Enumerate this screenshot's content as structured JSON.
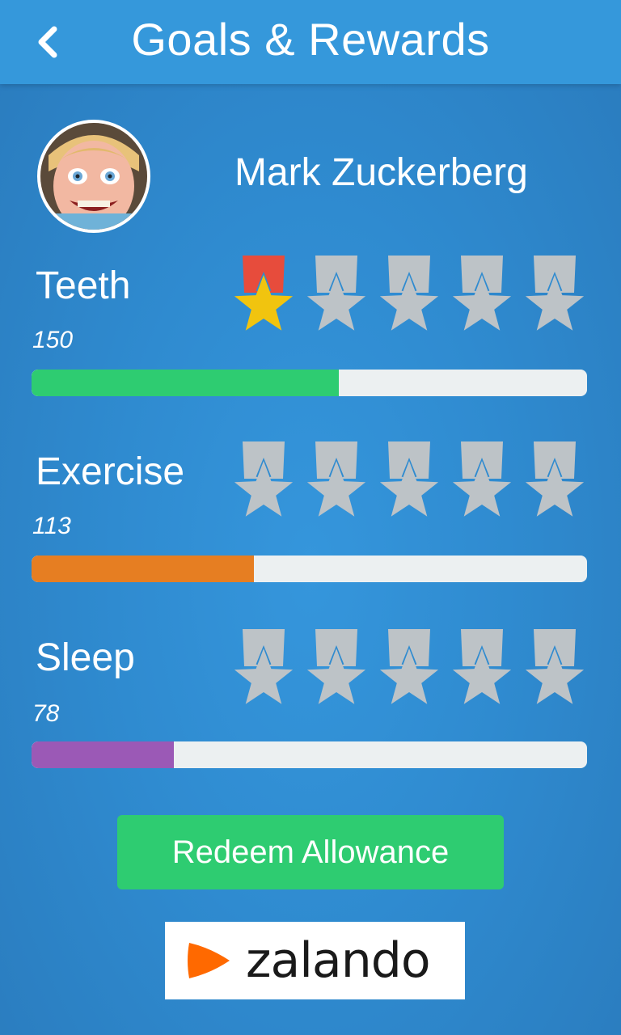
{
  "header": {
    "title": "Goals & Rewards",
    "back_icon": "chevron-left-icon"
  },
  "profile": {
    "name": "Mark Zuckerberg",
    "avatar_icon": "child-avatar"
  },
  "goals": [
    {
      "label": "Teeth",
      "value": "150",
      "progress": 0.553,
      "color": "#2ecc71",
      "stars_earned": 1,
      "stars_total": 5
    },
    {
      "label": "Exercise",
      "value": "113",
      "progress": 0.4,
      "color": "#e67e22",
      "stars_earned": 0,
      "stars_total": 5
    },
    {
      "label": "Sleep",
      "value": "78",
      "progress": 0.256,
      "color": "#9b59b6",
      "stars_earned": 0,
      "stars_total": 5
    }
  ],
  "medal_colors": {
    "earned_ribbon": "#e74c3c",
    "earned_star": "#f1c40f",
    "unearned": "#bdc3c7"
  },
  "actions": {
    "redeem_label": "Redeem Allowance"
  },
  "ad": {
    "brand": "zalando",
    "icon": "zalando-logo-icon",
    "brand_color": "#ff6900"
  }
}
